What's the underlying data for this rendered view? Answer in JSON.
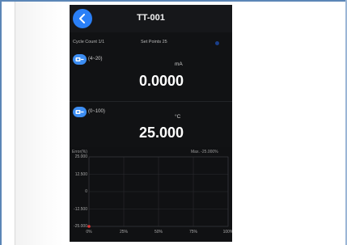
{
  "app": {
    "title": "TT-001"
  },
  "status": {
    "cycle_count": "Cycle Count 1/1",
    "set_points": "Set Points 25"
  },
  "channels": [
    {
      "icon": "mA-output-icon",
      "range": "(4~20)",
      "unit": "mA",
      "value": "0.0000"
    },
    {
      "icon": "temperature-sensor-icon",
      "range": "(0~100)",
      "unit": "°C",
      "value": "25.000"
    }
  ],
  "chart_data": {
    "type": "scatter",
    "ylabel": "Error(%)",
    "annotation": "Max. -25.000%",
    "x_ticks": [
      "0%",
      "25%",
      "50%",
      "75%",
      "100%"
    ],
    "y_ticks": [
      "25.000",
      "12.500",
      "0",
      "-12.500",
      "-25.000"
    ],
    "xlim": [
      0,
      100
    ],
    "ylim": [
      -25,
      25
    ],
    "grid": true,
    "series": [
      {
        "x": [
          0
        ],
        "y": [
          -25
        ],
        "color": "#e53935"
      }
    ]
  },
  "colors": {
    "accent": "#2a7ff6",
    "background": "#111214",
    "point": "#e53935"
  }
}
